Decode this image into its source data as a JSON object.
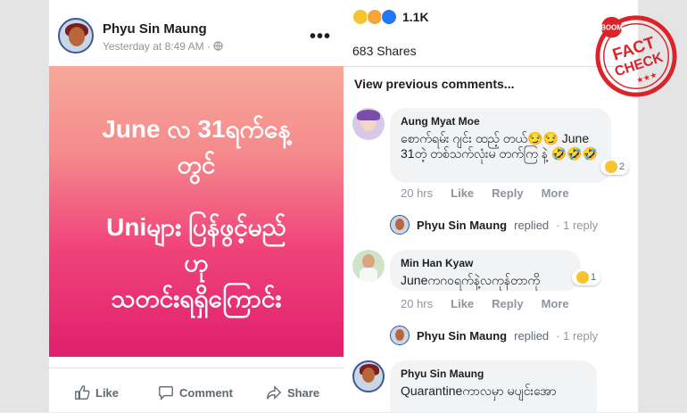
{
  "post": {
    "author": "Phyu Sin Maung",
    "meta": "Yesterday at 8:49 AM · ",
    "more": "•••",
    "image_text": [
      "June လ 31ရက်နေ့",
      "တွင်",
      "Uniများ ပြန်ဖွင့်မည်",
      "ဟု",
      "သတင်းရရှိကြောင်း"
    ],
    "actions": {
      "like": "Like",
      "comment": "Comment",
      "share": "Share"
    }
  },
  "stats": {
    "reactions_count": "1.1K",
    "shares": "683 Shares"
  },
  "view_previous": "View previous comments...",
  "comments": [
    {
      "name": "Aung Myat Moe",
      "text": "စောက်ရမ်း ဂျင်း ထည့် တယ်😏😏 June 31တဲ့ တစ်သက်လုံးမ တက်ကြ နဲ့ 🤣🤣🤣",
      "time": "20 hrs",
      "like": "Like",
      "reply": "Reply",
      "more": "More",
      "reaction_count": "2"
    },
    {
      "name": "Min Han Kyaw",
      "text": "Juneကဂ၀ရက်နဲ့လကုန်တာကို",
      "time": "20 hrs",
      "like": "Like",
      "reply": "Reply",
      "more": "More",
      "reaction_count": "1"
    },
    {
      "name": "Phyu Sin Maung",
      "text": "Quarantineကာလမှာ မပျင်းအော"
    }
  ],
  "replies": [
    {
      "name": "Phyu Sin Maung",
      "word": "replied",
      "count": "· 1 reply"
    },
    {
      "name": "Phyu Sin Maung",
      "word": "replied",
      "count": "· 1 reply"
    }
  ],
  "stamp": {
    "brand": "BOOM",
    "line1": "FACT",
    "line2": "CHECK",
    "stars": "★★★"
  },
  "colors": {
    "accent": "#3b5998",
    "stamp_red": "#d9252a",
    "image_top": "#f7a99a",
    "image_bottom": "#e01f6d"
  }
}
